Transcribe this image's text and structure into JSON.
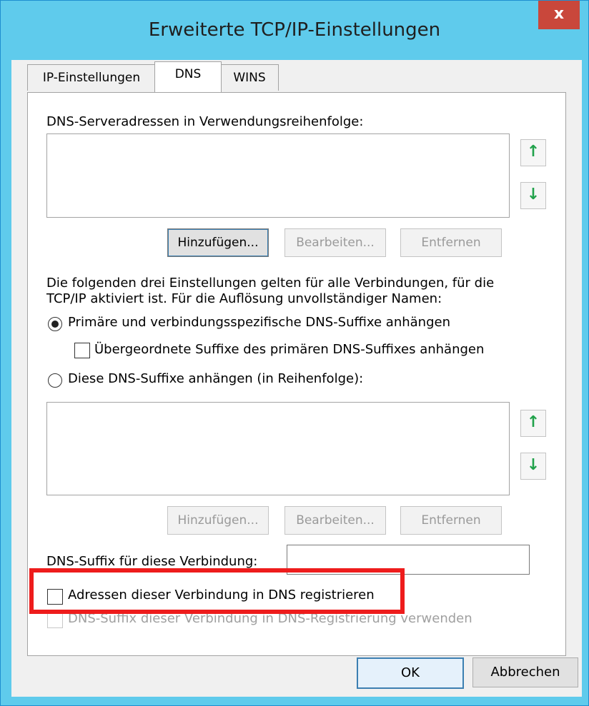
{
  "window": {
    "title": "Erweiterte TCP/IP-Einstellungen",
    "close_label": "x"
  },
  "tabs": [
    {
      "label": "IP-Einstellungen",
      "active": false
    },
    {
      "label": "DNS",
      "active": true
    },
    {
      "label": "WINS",
      "active": false
    }
  ],
  "dns_servers": {
    "label": "DNS-Serveradressen in Verwendungsreihenfolge:",
    "up_icon": "↑",
    "down_icon": "↓",
    "add_label": "Hinzufügen...",
    "edit_label": "Bearbeiten...",
    "remove_label": "Entfernen"
  },
  "info_text": {
    "line1": "Die folgenden drei Einstellungen gelten für alle Verbindungen, für die",
    "line2": "TCP/IP aktiviert ist. Für die Auflösung unvollständiger Namen:"
  },
  "options": {
    "primary_suffix_label": "Primäre und verbindungsspezifische DNS-Suffixe anhängen",
    "parent_suffix_label": "Übergeordnete Suffixe des primären DNS-Suffixes anhängen",
    "these_suffixes_label": "Diese DNS-Suffixe anhängen (in Reihenfolge):"
  },
  "suffix_list": {
    "up_icon": "↑",
    "down_icon": "↓",
    "add_label": "Hinzufügen...",
    "edit_label": "Bearbeiten...",
    "remove_label": "Entfernen"
  },
  "connection_suffix": {
    "label": "DNS-Suffix für diese Verbindung:",
    "value": ""
  },
  "register_label": "Adressen dieser Verbindung in DNS registrieren",
  "use_suffix_label": "DNS-Suffix dieser Verbindung in DNS-Registrierung verwenden",
  "footer": {
    "ok_label": "OK",
    "cancel_label": "Abbrechen"
  },
  "colors": {
    "titlebar": "#5fcbec",
    "close": "#c9473b",
    "highlight": "#ee1c1c",
    "arrow": "#21a24b"
  }
}
